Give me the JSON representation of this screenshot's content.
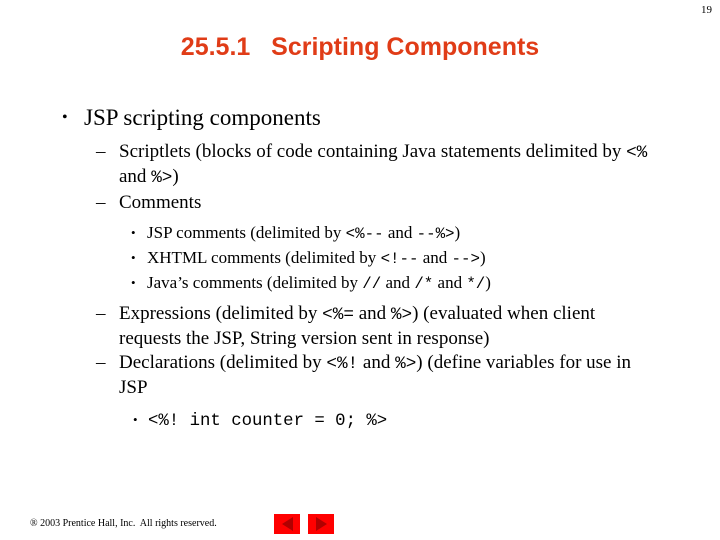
{
  "slide": {
    "page_number": "19",
    "title": "25.5.1   Scripting Components",
    "title_color": "#E03C17"
  },
  "content": {
    "level1": {
      "bullet_glyph": "•",
      "text": "JSP scripting components"
    },
    "items": [
      {
        "bullet_glyph": "–",
        "level": 2,
        "segments": [
          {
            "type": "text",
            "value": "Scriptlets (blocks of code containing Java statements delimited by "
          },
          {
            "type": "code",
            "value": "<%"
          },
          {
            "type": "text",
            "value": " and "
          },
          {
            "type": "code",
            "value": "%>"
          },
          {
            "type": "text",
            "value": ")"
          }
        ]
      },
      {
        "bullet_glyph": "–",
        "level": 2,
        "segments": [
          {
            "type": "text",
            "value": "Comments"
          }
        ]
      },
      {
        "bullet_glyph": "•",
        "level": 3,
        "segments": [
          {
            "type": "text",
            "value": "JSP comments (delimited by "
          },
          {
            "type": "code",
            "value": "<%--"
          },
          {
            "type": "text",
            "value": " and "
          },
          {
            "type": "code",
            "value": "--%>"
          },
          {
            "type": "text",
            "value": ")"
          }
        ]
      },
      {
        "bullet_glyph": "•",
        "level": 3,
        "segments": [
          {
            "type": "text",
            "value": "XHTML comments (delimited by "
          },
          {
            "type": "code",
            "value": "<!--"
          },
          {
            "type": "text",
            "value": " and "
          },
          {
            "type": "code",
            "value": "-->"
          },
          {
            "type": "text",
            "value": ")"
          }
        ]
      },
      {
        "bullet_glyph": "•",
        "level": 3,
        "segments": [
          {
            "type": "text",
            "value": "Java’s comments (delimited by "
          },
          {
            "type": "code",
            "value": "//"
          },
          {
            "type": "text",
            "value": " and "
          },
          {
            "type": "code",
            "value": "/*"
          },
          {
            "type": "text",
            "value": " and "
          },
          {
            "type": "code",
            "value": "*/"
          },
          {
            "type": "text",
            "value": ")"
          }
        ]
      },
      {
        "bullet_glyph": "–",
        "level": 2,
        "segments": [
          {
            "type": "text",
            "value": "Expressions (delimited by "
          },
          {
            "type": "code",
            "value": "<%="
          },
          {
            "type": "text",
            "value": " and "
          },
          {
            "type": "code",
            "value": "%>"
          },
          {
            "type": "text",
            "value": ") (evaluated when client requests the JSP, String version sent in response)"
          }
        ]
      },
      {
        "bullet_glyph": "–",
        "level": 2,
        "segments": [
          {
            "type": "text",
            "value": "Declarations (delimited by "
          },
          {
            "type": "code",
            "value": "<%!"
          },
          {
            "type": "text",
            "value": " and "
          },
          {
            "type": "code",
            "value": "%>"
          },
          {
            "type": "text",
            "value": ") (define variables for use in JSP"
          }
        ]
      },
      {
        "bullet_glyph": "•",
        "level": 3,
        "code_line": true,
        "segments": [
          {
            "type": "code",
            "value": "<%! int counter = 0; %>"
          }
        ]
      }
    ]
  },
  "footer": {
    "copyright": "® 2003 Prentice Hall, Inc.  All rights reserved.",
    "nav": {
      "back_label": "back-arrow",
      "forward_label": "forward-arrow",
      "button_color": "#FF0000",
      "arrow_color": "#B00000"
    }
  }
}
